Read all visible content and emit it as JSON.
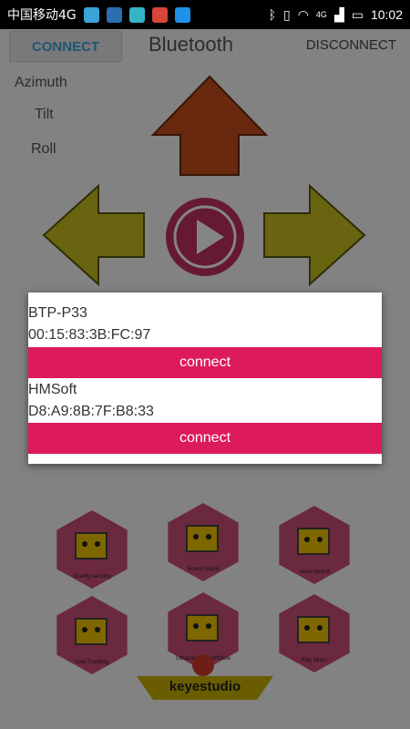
{
  "status_bar": {
    "carrier": "中国移动4G",
    "network": "4G",
    "time": "10:02"
  },
  "app": {
    "connect_label": "CONNECT",
    "title": "Bluetooth",
    "disconnect_label": "DISCONNECT",
    "labels": {
      "azimuth": "Azimuth",
      "tilt": "Tilt",
      "roll": "Roll"
    },
    "modes": [
      {
        "label": "Gravity sensing"
      },
      {
        "label": "Sound Matrix"
      },
      {
        "label": "voice control"
      },
      {
        "label": "Line Tracking"
      },
      {
        "label": "Ultrasonic Avoid/follow"
      },
      {
        "label": "Play Music"
      }
    ],
    "brand": "keyestudio"
  },
  "dialog": {
    "devices": [
      {
        "name": "BTP-P33",
        "address": "00:15:83:3B:FC:97",
        "button": "connect"
      },
      {
        "name": "HMSoft",
        "address": "D8:A9:8B:7F:B8:33",
        "button": "connect"
      }
    ]
  },
  "colors": {
    "accent": "#dd1a5c",
    "connect_text": "#3aa3d8",
    "up_arrow": "#c8501e",
    "side_arrow": "#c8c01e",
    "play_button": "#c43060"
  }
}
